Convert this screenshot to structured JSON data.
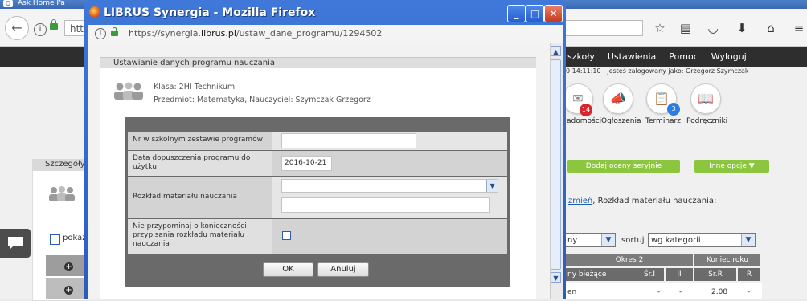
{
  "background_window": {
    "tab_title": "Ask Home Pa",
    "url_prefix": "http",
    "menu": [
      "szkoły",
      "Ustawienia",
      "Pomoc",
      "Wyloguj"
    ],
    "status_line": "0 14:11:10  |  jesteś zalogowany jako: Grzegorz Szymczak",
    "tiles": [
      {
        "label": "adomości",
        "badge": "14",
        "icon": "envelope-icon",
        "badge_color": "#d9262d"
      },
      {
        "label": "Ogłoszenia",
        "icon": "megaphone-icon"
      },
      {
        "label": "Terminarz",
        "badge": "3",
        "icon": "calendar-icon",
        "badge_color": "#2a7de1"
      },
      {
        "label": "Podręczniki",
        "icon": "book-icon"
      }
    ],
    "left_panel_title": "Szczegóły",
    "left_show_label": "pokaż",
    "green_buttons": {
      "add_grades": "Dodaj oceny seryjnie",
      "more_options": "Inne opcje ▼"
    },
    "links_text": {
      "change_link": "zmień",
      "rest": ", Rozkład materiału nauczania:"
    },
    "filter_select": "ny",
    "sort_label": "sortuj",
    "sort_select": "wg kategorii",
    "table": {
      "group_headers": [
        "Okres 2",
        "Koniec roku"
      ],
      "columns": [
        "ny bieżące",
        "Śr.I",
        "II",
        "Śr.R",
        "R"
      ],
      "row": [
        "en",
        "-",
        "-",
        "2.08",
        "-"
      ]
    }
  },
  "popup": {
    "title": "LIBRUS Synergia - Mozilla Firefox",
    "url": {
      "prefix": "https://synergia.",
      "domain": "librus.pl",
      "path": "/ustaw_dane_programu/1294502"
    },
    "section_title": "Ustawianie danych programu nauczania",
    "class_line": "Klasa: 2HI Technikum",
    "subject_line": "Przedmiot: Matematyka, Nauczyciel: Szymczak Grzegorz",
    "form": {
      "program_number_label": "Nr w szkolnym zestawie programów",
      "program_number_value": "",
      "approval_date_label": "Data dopuszczenia programu do użytku",
      "approval_date_value": "2016-10-21",
      "distribution_label": "Rozkład materiału nauczania",
      "distribution_select_value": "",
      "distribution_text_value": "",
      "no_reminder_label": "Nie przypominaj o konieczności przypisania rozkładu materiału nauczania",
      "no_reminder_checked": false
    },
    "buttons": {
      "ok": "OK",
      "cancel": "Anuluj"
    }
  }
}
